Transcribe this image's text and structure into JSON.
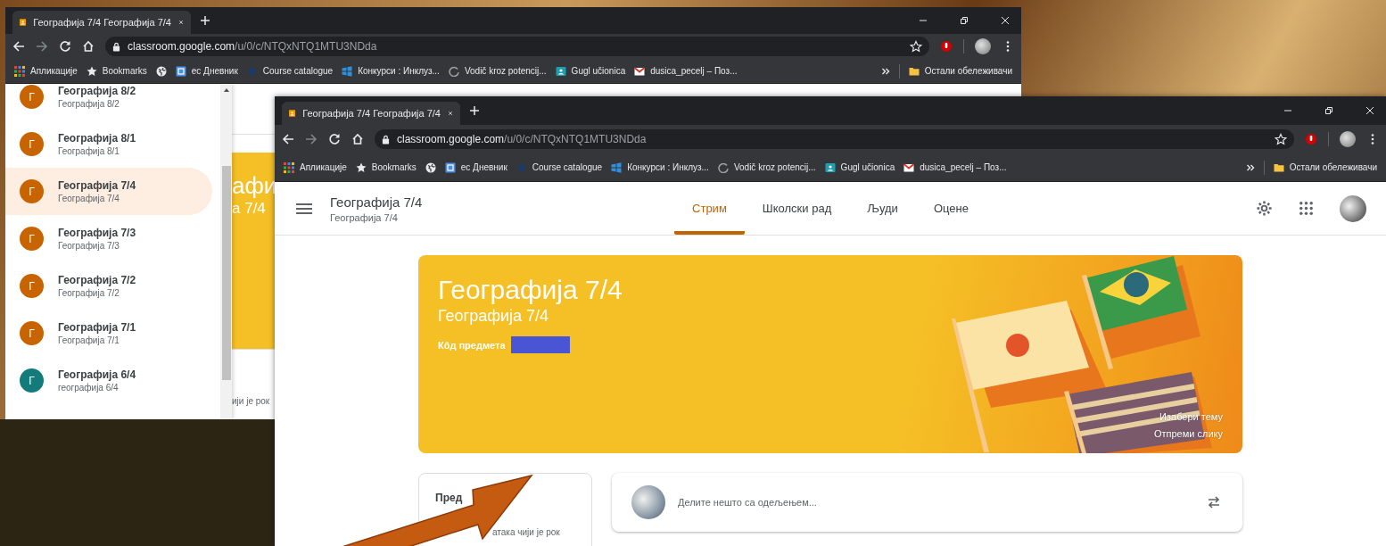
{
  "back_window": {
    "tab_title": "Географија 7/4 Географија 7/4",
    "url_host": "classroom.google.com",
    "url_path": "/u/0/c/NTQxNTQ1MTU3NDda",
    "bookmarks": [
      {
        "kind": "apps",
        "label": "Апликације"
      },
      {
        "kind": "star",
        "label": "Bookmarks"
      },
      {
        "kind": "globe"
      },
      {
        "kind": "doc",
        "label": "ес Дневник"
      },
      {
        "kind": "cap",
        "label": "Course catalogue"
      },
      {
        "kind": "tiles",
        "label": "Конкурси : Инклуз..."
      },
      {
        "kind": "loading",
        "label": "Vodič kroz potencij..."
      },
      {
        "kind": "classroom",
        "label": "Gugl učionica"
      },
      {
        "kind": "mail",
        "label": "dusica_pecelj – Поз..."
      }
    ],
    "other_bookmarks": "Остали обележивачи",
    "class_list": [
      {
        "name": "Географија 8/2",
        "section": "Географија 8/2",
        "initial": "Г",
        "color": "#c86400",
        "selected": false
      },
      {
        "name": "Географија 8/1",
        "section": "Географија 8/1",
        "initial": "Г",
        "color": "#c86400",
        "selected": false
      },
      {
        "name": "Географија 7/4",
        "section": "Географија 7/4",
        "initial": "Г",
        "color": "#c86400",
        "selected": true
      },
      {
        "name": "Географија 7/3",
        "section": "Географија 7/3",
        "initial": "Г",
        "color": "#c86400",
        "selected": false
      },
      {
        "name": "Географија 7/2",
        "section": "Географија 7/2",
        "initial": "Г",
        "color": "#c86400",
        "selected": false
      },
      {
        "name": "Географија 7/1",
        "section": "Географија 7/1",
        "initial": "Г",
        "color": "#c86400",
        "selected": false
      },
      {
        "name": "Географија 6/4",
        "section": "географија 6/4",
        "initial": "Г",
        "color": "#137c7a",
        "selected": false
      }
    ],
    "page_fragments": {
      "title": "афи",
      "subtitle": "а 7/4",
      "footer": "ији је рок"
    }
  },
  "front_window": {
    "tab_title": "Географија 7/4 Географија 7/4",
    "url_host": "classroom.google.com",
    "url_path": "/u/0/c/NTQxNTQ1MTU3NDda",
    "bookmarks": [
      {
        "kind": "apps",
        "label": "Апликације"
      },
      {
        "kind": "star",
        "label": "Bookmarks"
      },
      {
        "kind": "globe"
      },
      {
        "kind": "doc",
        "label": "ес Дневник"
      },
      {
        "kind": "cap",
        "label": "Course catalogue"
      },
      {
        "kind": "tiles",
        "label": "Конкурси : Инклуз..."
      },
      {
        "kind": "loading",
        "label": "Vodič kroz potencij..."
      },
      {
        "kind": "classroom",
        "label": "Gugl učionica"
      },
      {
        "kind": "mail",
        "label": "dusica_pecelj – Поз..."
      }
    ],
    "other_bookmarks": "Остали обележивачи",
    "classroom": {
      "title": "Географија 7/4",
      "subtitle": "Географија 7/4",
      "tabs": [
        {
          "label": "Стрим",
          "selected": true
        },
        {
          "label": "Школски рад",
          "selected": false
        },
        {
          "label": "Људи",
          "selected": false
        },
        {
          "label": "Оцене",
          "selected": false
        }
      ],
      "banner": {
        "title": "Географија 7/4",
        "subtitle": "Географија 7/4",
        "code_label": "Кôд предмета",
        "links": [
          "Изабери тему",
          "Отпреми слику"
        ]
      },
      "upcoming": {
        "title": "Пред",
        "text": "атака чији је рок"
      },
      "share": {
        "prompt": "Делите нешто са одељењем..."
      }
    }
  }
}
